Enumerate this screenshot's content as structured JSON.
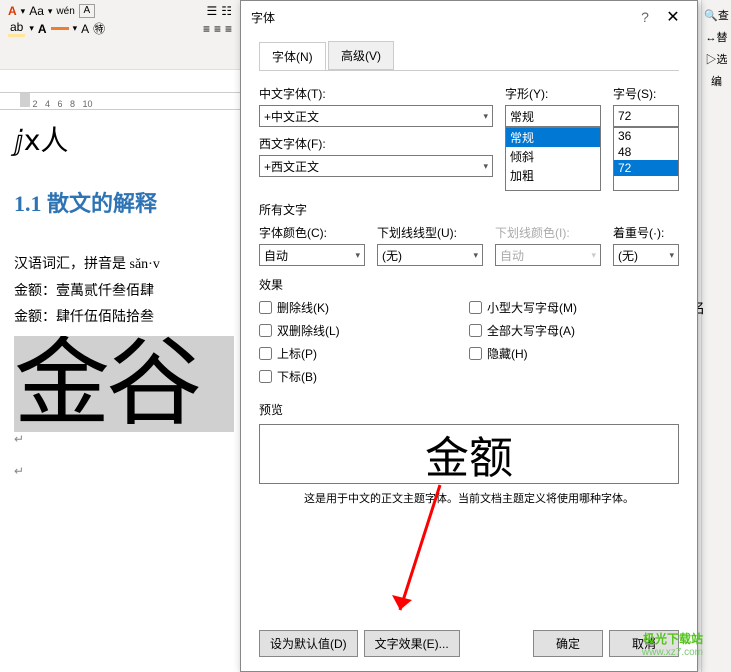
{
  "ribbon": {
    "wen_label": "wén",
    "box_a": "A"
  },
  "right_sidebar": [
    "查",
    "替",
    "选",
    "编"
  ],
  "doc": {
    "heading": "1.1 散文的解释",
    "line1": "汉语词汇，拼音是 sǎn·v",
    "line2": "金额：壹萬贰仟叁佰肆",
    "line3": "金额：肆仟伍佰陆拾叁",
    "big_sel": "金谷",
    "far_right": "本名"
  },
  "dialog": {
    "title": "字体",
    "tabs": {
      "font": "字体(N)",
      "advanced": "高级(V)"
    },
    "labels": {
      "cn_font": "中文字体(T):",
      "en_font": "西文字体(F):",
      "style": "字形(Y):",
      "size": "字号(S):",
      "all_text": "所有文字",
      "font_color": "字体颜色(C):",
      "underline": "下划线线型(U):",
      "underline_color": "下划线颜色(I):",
      "emphasis": "着重号(·):",
      "effects": "效果",
      "preview": "预览"
    },
    "values": {
      "cn_font": "+中文正文",
      "en_font": "+西文正文",
      "style_input": "常规",
      "size_input": "72",
      "font_color": "自动",
      "underline": "(无)",
      "underline_color": "自动",
      "emphasis": "(无)"
    },
    "style_list": [
      "常规",
      "倾斜",
      "加粗"
    ],
    "size_list": [
      "36",
      "48",
      "72"
    ],
    "effects": {
      "strike": "删除线(K)",
      "dstrike": "双删除线(L)",
      "sup": "上标(P)",
      "sub": "下标(B)",
      "smallcaps": "小型大写字母(M)",
      "allcaps": "全部大写字母(A)",
      "hidden": "隐藏(H)"
    },
    "preview_text": "金额",
    "preview_desc": "这是用于中文的正文主题字体。当前文档主题定义将使用哪种字体。",
    "buttons": {
      "default": "设为默认值(D)",
      "text_effect": "文字效果(E)...",
      "ok": "确定",
      "cancel": "取消"
    }
  },
  "watermark": {
    "line1": "极光下载站",
    "line2": "www.xz7.com"
  }
}
